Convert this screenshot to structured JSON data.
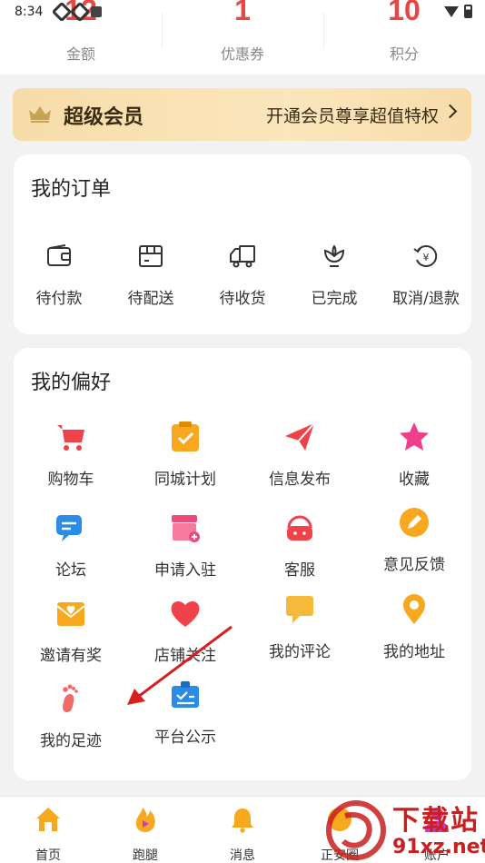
{
  "status_bar": {
    "time": "8:34",
    "icons": [
      "app-icon",
      "app-icon",
      "notification-icon",
      "wifi-icon",
      "battery-icon"
    ]
  },
  "stats": [
    {
      "value": "12",
      "label": "金额"
    },
    {
      "value": "1",
      "label": "优惠券"
    },
    {
      "value": "10",
      "label": "积分"
    }
  ],
  "vip": {
    "title": "超级会员",
    "desc": "开通会员尊享超值特权"
  },
  "orders": {
    "title": "我的订单",
    "items": [
      {
        "label": "待付款",
        "icon": "wallet-icon"
      },
      {
        "label": "待配送",
        "icon": "box-icon"
      },
      {
        "label": "待收货",
        "icon": "truck-icon"
      },
      {
        "label": "已完成",
        "icon": "flower-icon"
      },
      {
        "label": "取消/退款",
        "icon": "refund-icon"
      }
    ]
  },
  "prefs": {
    "title": "我的偏好",
    "items": [
      {
        "label": "购物车",
        "icon": "cart-icon"
      },
      {
        "label": "同城计划",
        "icon": "clipboard-check-icon"
      },
      {
        "label": "信息发布",
        "icon": "paper-plane-icon"
      },
      {
        "label": "收藏",
        "icon": "star-icon"
      },
      {
        "label": "论坛",
        "icon": "chat-icon"
      },
      {
        "label": "申请入驻",
        "icon": "store-icon"
      },
      {
        "label": "客服",
        "icon": "headset-icon"
      },
      {
        "label": "意见反馈",
        "icon": "pencil-icon"
      },
      {
        "label": "邀请有奖",
        "icon": "envelope-heart-icon"
      },
      {
        "label": "店铺关注",
        "icon": "heart-icon"
      },
      {
        "label": "我的评论",
        "icon": "comment-icon"
      },
      {
        "label": "我的地址",
        "icon": "location-pin-icon"
      },
      {
        "label": "我的足迹",
        "icon": "footprint-icon"
      },
      {
        "label": "平台公示",
        "icon": "notice-board-icon"
      }
    ]
  },
  "tabbar": [
    {
      "label": "首页",
      "icon": "home-icon"
    },
    {
      "label": "跑腿",
      "icon": "errand-icon"
    },
    {
      "label": "消息",
      "icon": "bell-icon"
    },
    {
      "label": "正安圈",
      "icon": "circle-icon"
    },
    {
      "label": "账户",
      "icon": "account-icon"
    }
  ],
  "colors": {
    "accent_red": "#e84545",
    "vip_gold": "#f6dca8",
    "annotation_arrow": "#d62020"
  },
  "watermark": {
    "line1": "下载站",
    "line2": "91xz.net"
  }
}
